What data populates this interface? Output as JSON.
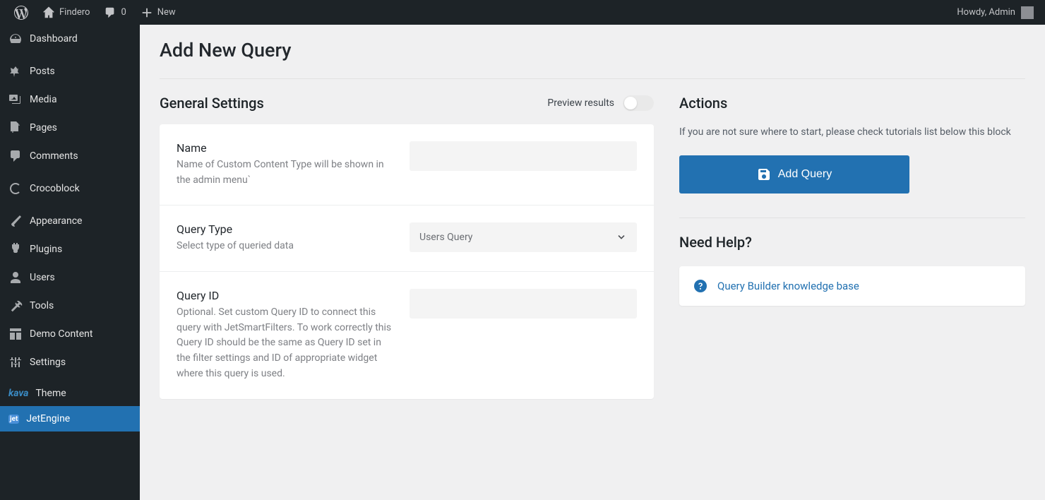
{
  "adminBar": {
    "siteName": "Findero",
    "commentsCount": "0",
    "newLabel": "New",
    "greeting": "Howdy, Admin"
  },
  "sidebar": {
    "items": [
      {
        "label": "Dashboard"
      },
      {
        "label": "Posts"
      },
      {
        "label": "Media"
      },
      {
        "label": "Pages"
      },
      {
        "label": "Comments"
      },
      {
        "label": "Crocoblock"
      },
      {
        "label": "Appearance"
      },
      {
        "label": "Plugins"
      },
      {
        "label": "Users"
      },
      {
        "label": "Tools"
      },
      {
        "label": "Demo Content"
      },
      {
        "label": "Settings"
      },
      {
        "label": "Theme",
        "prefix": "kava"
      },
      {
        "label": "JetEngine"
      }
    ]
  },
  "page": {
    "title": "Add New Query"
  },
  "general": {
    "title": "General Settings",
    "previewLabel": "Preview results",
    "fields": {
      "name": {
        "label": "Name",
        "desc": "Name of Custom Content Type will be shown in the admin menu`",
        "value": ""
      },
      "queryType": {
        "label": "Query Type",
        "desc": "Select type of queried data",
        "value": "Users Query"
      },
      "queryId": {
        "label": "Query ID",
        "desc": "Optional. Set custom Query ID to connect this query with JetSmartFilters. To work correctly this Query ID should be the same as Query ID set in the filter settings and ID of appropriate widget where this query is used.",
        "value": ""
      }
    }
  },
  "actions": {
    "title": "Actions",
    "desc": "If you are not sure where to start, please check tutorials list below this block",
    "buttonLabel": "Add Query"
  },
  "help": {
    "title": "Need Help?",
    "linkLabel": "Query Builder knowledge base"
  }
}
